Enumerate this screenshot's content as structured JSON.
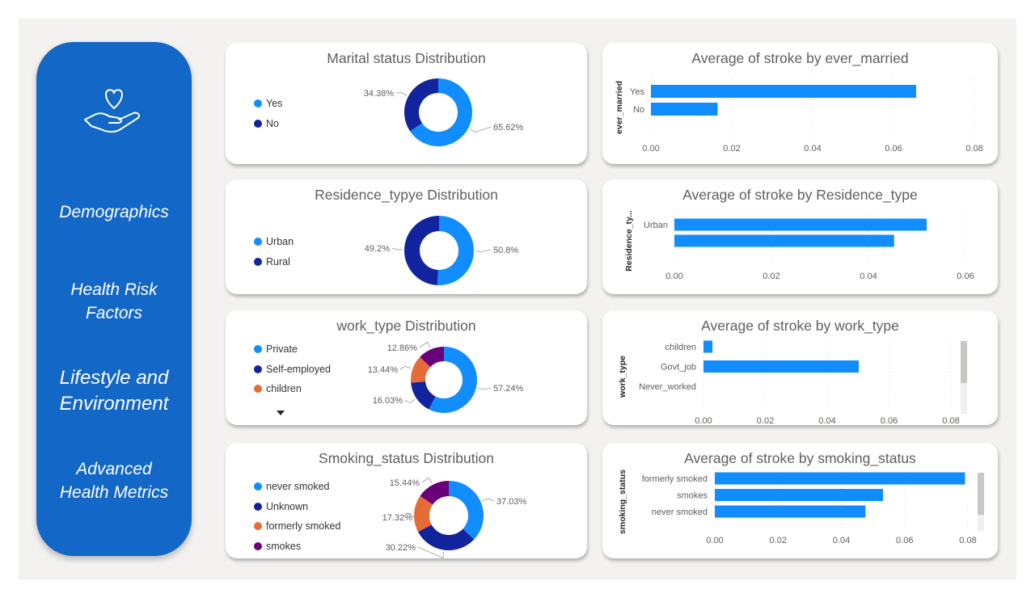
{
  "sidebar": {
    "logo_icon": "heart-in-hand-icon",
    "nav": {
      "demographics": "Demographics",
      "health_line1": "Health Risk",
      "health_line2": "Factors",
      "lifestyle_line1": "Lifestyle and",
      "lifestyle_line2": "Environment",
      "advanced_line1": "Advanced",
      "advanced_line2": "Health Metrics"
    },
    "color": "#1367c6"
  },
  "colors": {
    "light_blue": "#118dff",
    "dark_blue": "#12239e",
    "orange": "#e66c37",
    "purple": "#6b007b",
    "bar": "#118dff"
  },
  "donuts": {
    "marital": {
      "title": "Marital status Distribution",
      "legend": [
        "Yes",
        "No"
      ]
    },
    "residence": {
      "title": "Residence_typye Distribution",
      "legend": [
        "Urban",
        "Rural"
      ]
    },
    "work": {
      "title": "work_type Distribution",
      "legend": [
        "Private",
        "Self-employed",
        "children"
      ]
    },
    "smoking": {
      "title": "Smoking_status Distribution",
      "legend": [
        "never smoked",
        "Unknown",
        "formerly smoked",
        "smokes"
      ]
    }
  },
  "bars": {
    "married": {
      "title": "Average of stroke by ever_married",
      "axis_title": "ever_married"
    },
    "residence": {
      "title": "Average of stroke by Residence_type",
      "axis_title": "Residence_ty..."
    },
    "work": {
      "title": "Average of stroke by work_type",
      "axis_title": "work_type"
    },
    "smoking": {
      "title": "Average of stroke by smoking_status",
      "axis_title": "smoking_status"
    }
  },
  "chart_data": [
    {
      "type": "pie",
      "title": "Marital status Distribution",
      "categories": [
        "Yes",
        "No"
      ],
      "values": [
        65.62,
        34.38
      ],
      "labels": [
        "65.62%",
        "34.38%"
      ],
      "colors": [
        "#118dff",
        "#12239e"
      ]
    },
    {
      "type": "pie",
      "title": "Residence_typye Distribution",
      "categories": [
        "Urban",
        "Rural"
      ],
      "values": [
        50.8,
        49.2
      ],
      "labels": [
        "50.8%",
        "49.2%"
      ],
      "colors": [
        "#118dff",
        "#12239e"
      ]
    },
    {
      "type": "pie",
      "title": "work_type Distribution",
      "categories": [
        "Private",
        "Self-employed",
        "children",
        ""
      ],
      "values": [
        57.24,
        16.03,
        13.44,
        12.86
      ],
      "labels": [
        "57.24%",
        "16.03%",
        "13.44%",
        "12.86%"
      ],
      "colors": [
        "#118dff",
        "#12239e",
        "#e66c37",
        "#6b007b"
      ]
    },
    {
      "type": "pie",
      "title": "Smoking_status Distribution",
      "categories": [
        "never smoked",
        "Unknown",
        "formerly smoked",
        "smokes"
      ],
      "values": [
        37.03,
        30.22,
        17.32,
        15.44
      ],
      "labels": [
        "37.03%",
        "30.22%",
        "17.32%",
        "15.44%"
      ],
      "colors": [
        "#118dff",
        "#12239e",
        "#e66c37",
        "#6b007b"
      ]
    },
    {
      "type": "bar",
      "title": "Average of stroke by ever_married",
      "ylabel": "ever_married",
      "categories": [
        "Yes",
        "No"
      ],
      "values": [
        0.0656,
        0.0165
      ],
      "xlim": [
        0,
        0.08
      ],
      "ticks": [
        "0.00",
        "0.02",
        "0.04",
        "0.06",
        "0.08"
      ]
    },
    {
      "type": "bar",
      "title": "Average of stroke by Residence_type",
      "ylabel": "Residence_ty...",
      "categories": [
        "Urban",
        ""
      ],
      "values": [
        0.052,
        0.0453
      ],
      "xlim": [
        0,
        0.06
      ],
      "ticks": [
        "0.00",
        "0.02",
        "0.04",
        "0.06"
      ]
    },
    {
      "type": "bar",
      "title": "Average of stroke by work_type",
      "ylabel": "work_type",
      "categories": [
        "children",
        "Govt_job",
        "Never_worked"
      ],
      "values": [
        0.0029,
        0.0502,
        0.0
      ],
      "xlim": [
        0,
        0.08
      ],
      "ticks": [
        "0.00",
        "0.02",
        "0.04",
        "0.06",
        "0.08"
      ]
    },
    {
      "type": "bar",
      "title": "Average of stroke by smoking_status",
      "ylabel": "smoking_status",
      "categories": [
        "formerly smoked",
        "smokes",
        "never smoked"
      ],
      "values": [
        0.0791,
        0.0532,
        0.0476
      ],
      "xlim": [
        0,
        0.08
      ],
      "ticks": [
        "0.00",
        "0.02",
        "0.04",
        "0.06",
        "0.08"
      ]
    }
  ]
}
